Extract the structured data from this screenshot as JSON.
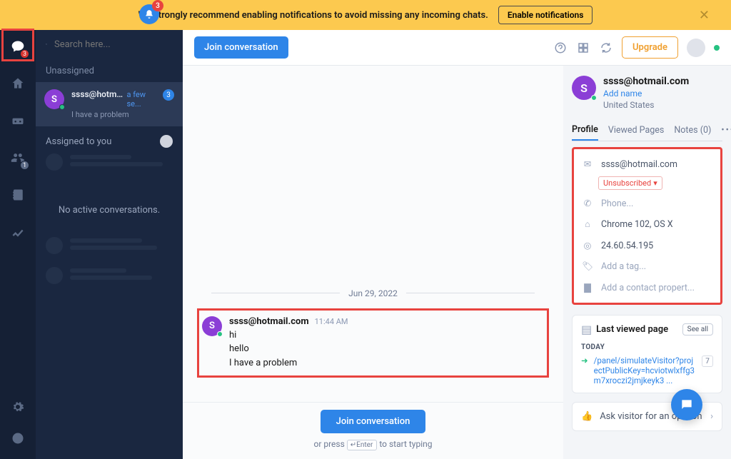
{
  "banner": {
    "badge": "3",
    "text": "We strongly recommend enabling notifications to avoid missing any incoming chats.",
    "button": "Enable notifications"
  },
  "rail": {
    "chat_badge": "3",
    "contacts_badge": "1"
  },
  "sidebar": {
    "search_placeholder": "Search here...",
    "unassigned_label": "Unassigned",
    "conversation": {
      "avatar_letter": "S",
      "title": "ssss@hotmail....",
      "time": "a few se...",
      "preview": "I have a problem",
      "count": "3"
    },
    "assigned_label": "Assigned to you",
    "no_conv": "No active conversations."
  },
  "topbar": {
    "join": "Join conversation",
    "upgrade": "Upgrade"
  },
  "chat": {
    "date": "Jun 29, 2022",
    "sender_letter": "S",
    "sender": "ssss@hotmail.com",
    "time": "11:44 AM",
    "lines": [
      "hi",
      "hello",
      "I have a problem"
    ],
    "join": "Join conversation",
    "press_prefix": "or press",
    "key": "↵Enter",
    "press_suffix": "to start typing"
  },
  "detail": {
    "avatar_letter": "S",
    "name": "ssss@hotmail.com",
    "add_name": "Add name",
    "location": "United States",
    "tabs": {
      "profile": "Profile",
      "viewed": "Viewed Pages",
      "notes": "Notes (0)"
    },
    "profile": {
      "email": "ssss@hotmail.com",
      "unsub": "Unsubscribed",
      "phone": "Phone...",
      "device": "Chrome 102, OS X",
      "ip": "24.60.54.195",
      "tag": "Add a tag...",
      "property": "Add a contact propert..."
    },
    "viewed": {
      "title": "Last viewed page",
      "see_all": "See all",
      "today": "TODAY",
      "url": "/panel/simulateVisitor?projectPublicKey=hcviotwlxffg3m7xroczi2jmjkeyk3 ...",
      "count": "7"
    },
    "ask": "Ask visitor for an opinion"
  }
}
